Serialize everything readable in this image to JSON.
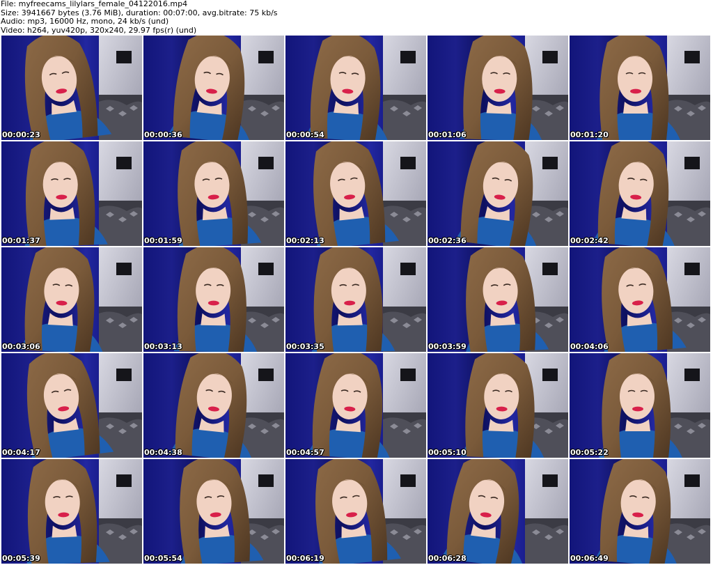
{
  "info": {
    "file": "File: myfreecams_lilylars_female_04122016.mp4",
    "size": "Size: 3941667 bytes (3.76 MiB), duration: 00:07:00, avg.bitrate: 75 kb/s",
    "audio": "Audio: mp3, 16000 Hz, mono, 24 kb/s (und)",
    "video": "Video: h264, yuv420p, 320x240, 29.97 fps(r) (und)"
  },
  "thumbnails": [
    {
      "time": "00:00:23"
    },
    {
      "time": "00:00:36"
    },
    {
      "time": "00:00:54"
    },
    {
      "time": "00:01:06"
    },
    {
      "time": "00:01:20"
    },
    {
      "time": "00:01:37"
    },
    {
      "time": "00:01:59"
    },
    {
      "time": "00:02:13"
    },
    {
      "time": "00:02:36"
    },
    {
      "time": "00:02:42"
    },
    {
      "time": "00:03:06"
    },
    {
      "time": "00:03:13"
    },
    {
      "time": "00:03:35"
    },
    {
      "time": "00:03:59"
    },
    {
      "time": "00:04:06"
    },
    {
      "time": "00:04:17"
    },
    {
      "time": "00:04:38"
    },
    {
      "time": "00:04:57"
    },
    {
      "time": "00:05:10"
    },
    {
      "time": "00:05:22"
    },
    {
      "time": "00:05:39"
    },
    {
      "time": "00:05:54"
    },
    {
      "time": "00:06:19"
    },
    {
      "time": "00:06:28"
    },
    {
      "time": "00:06:49"
    }
  ],
  "colors": {
    "curtain": "#1c1f8a",
    "wall": "#c9c9d3",
    "hair": "#7a5a3a",
    "sweater": "#1f5fb0",
    "skin": "#f1d2c2",
    "lips": "#d8204a"
  }
}
